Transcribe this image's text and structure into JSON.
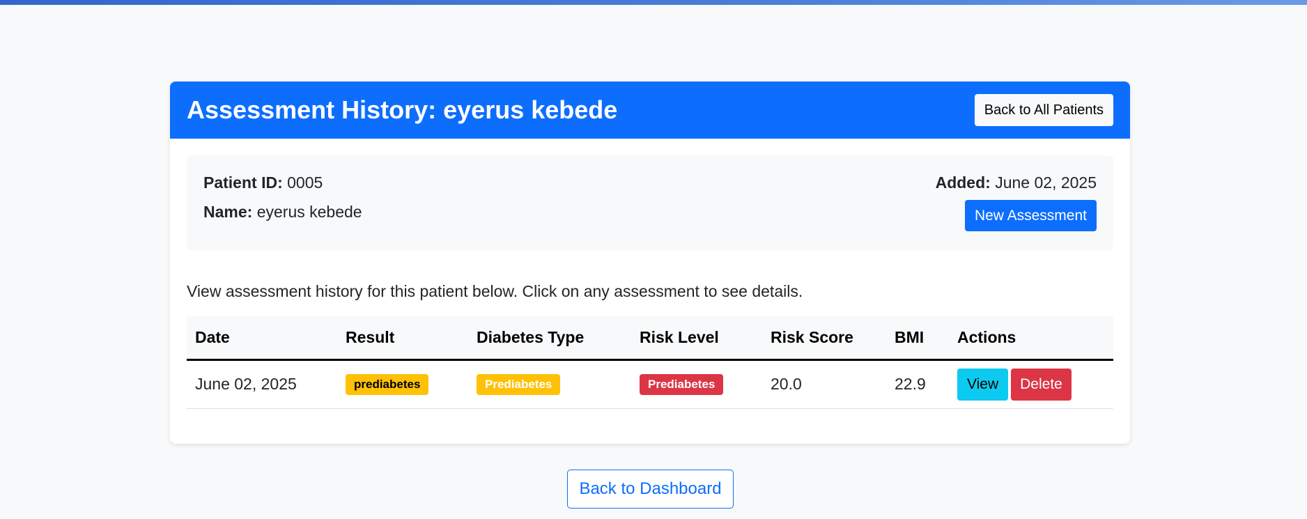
{
  "header": {
    "title": "Assessment History: eyerus kebede",
    "back_patients_label": "Back to All Patients"
  },
  "patient": {
    "id_label": "Patient ID:",
    "id_value": "0005",
    "name_label": "Name:",
    "name_value": "eyerus kebede",
    "added_label": "Added:",
    "added_value": "June 02, 2025",
    "new_assessment_label": "New Assessment"
  },
  "intro_text": "View assessment history for this patient below. Click on any assessment to see details.",
  "table": {
    "columns": [
      "Date",
      "Result",
      "Diabetes Type",
      "Risk Level",
      "Risk Score",
      "BMI",
      "Actions"
    ],
    "rows": [
      {
        "date": "June 02, 2025",
        "result": "prediabetes",
        "diabetes_type": "Prediabetes",
        "risk_level": "Prediabetes",
        "risk_score": "20.0",
        "bmi": "22.9",
        "view_label": "View",
        "delete_label": "Delete"
      }
    ]
  },
  "footer": {
    "back_dashboard_label": "Back to Dashboard"
  },
  "colors": {
    "primary": "#0d6efd",
    "warning": "#ffc107",
    "danger": "#dc3545",
    "info": "#0dcaf0"
  }
}
